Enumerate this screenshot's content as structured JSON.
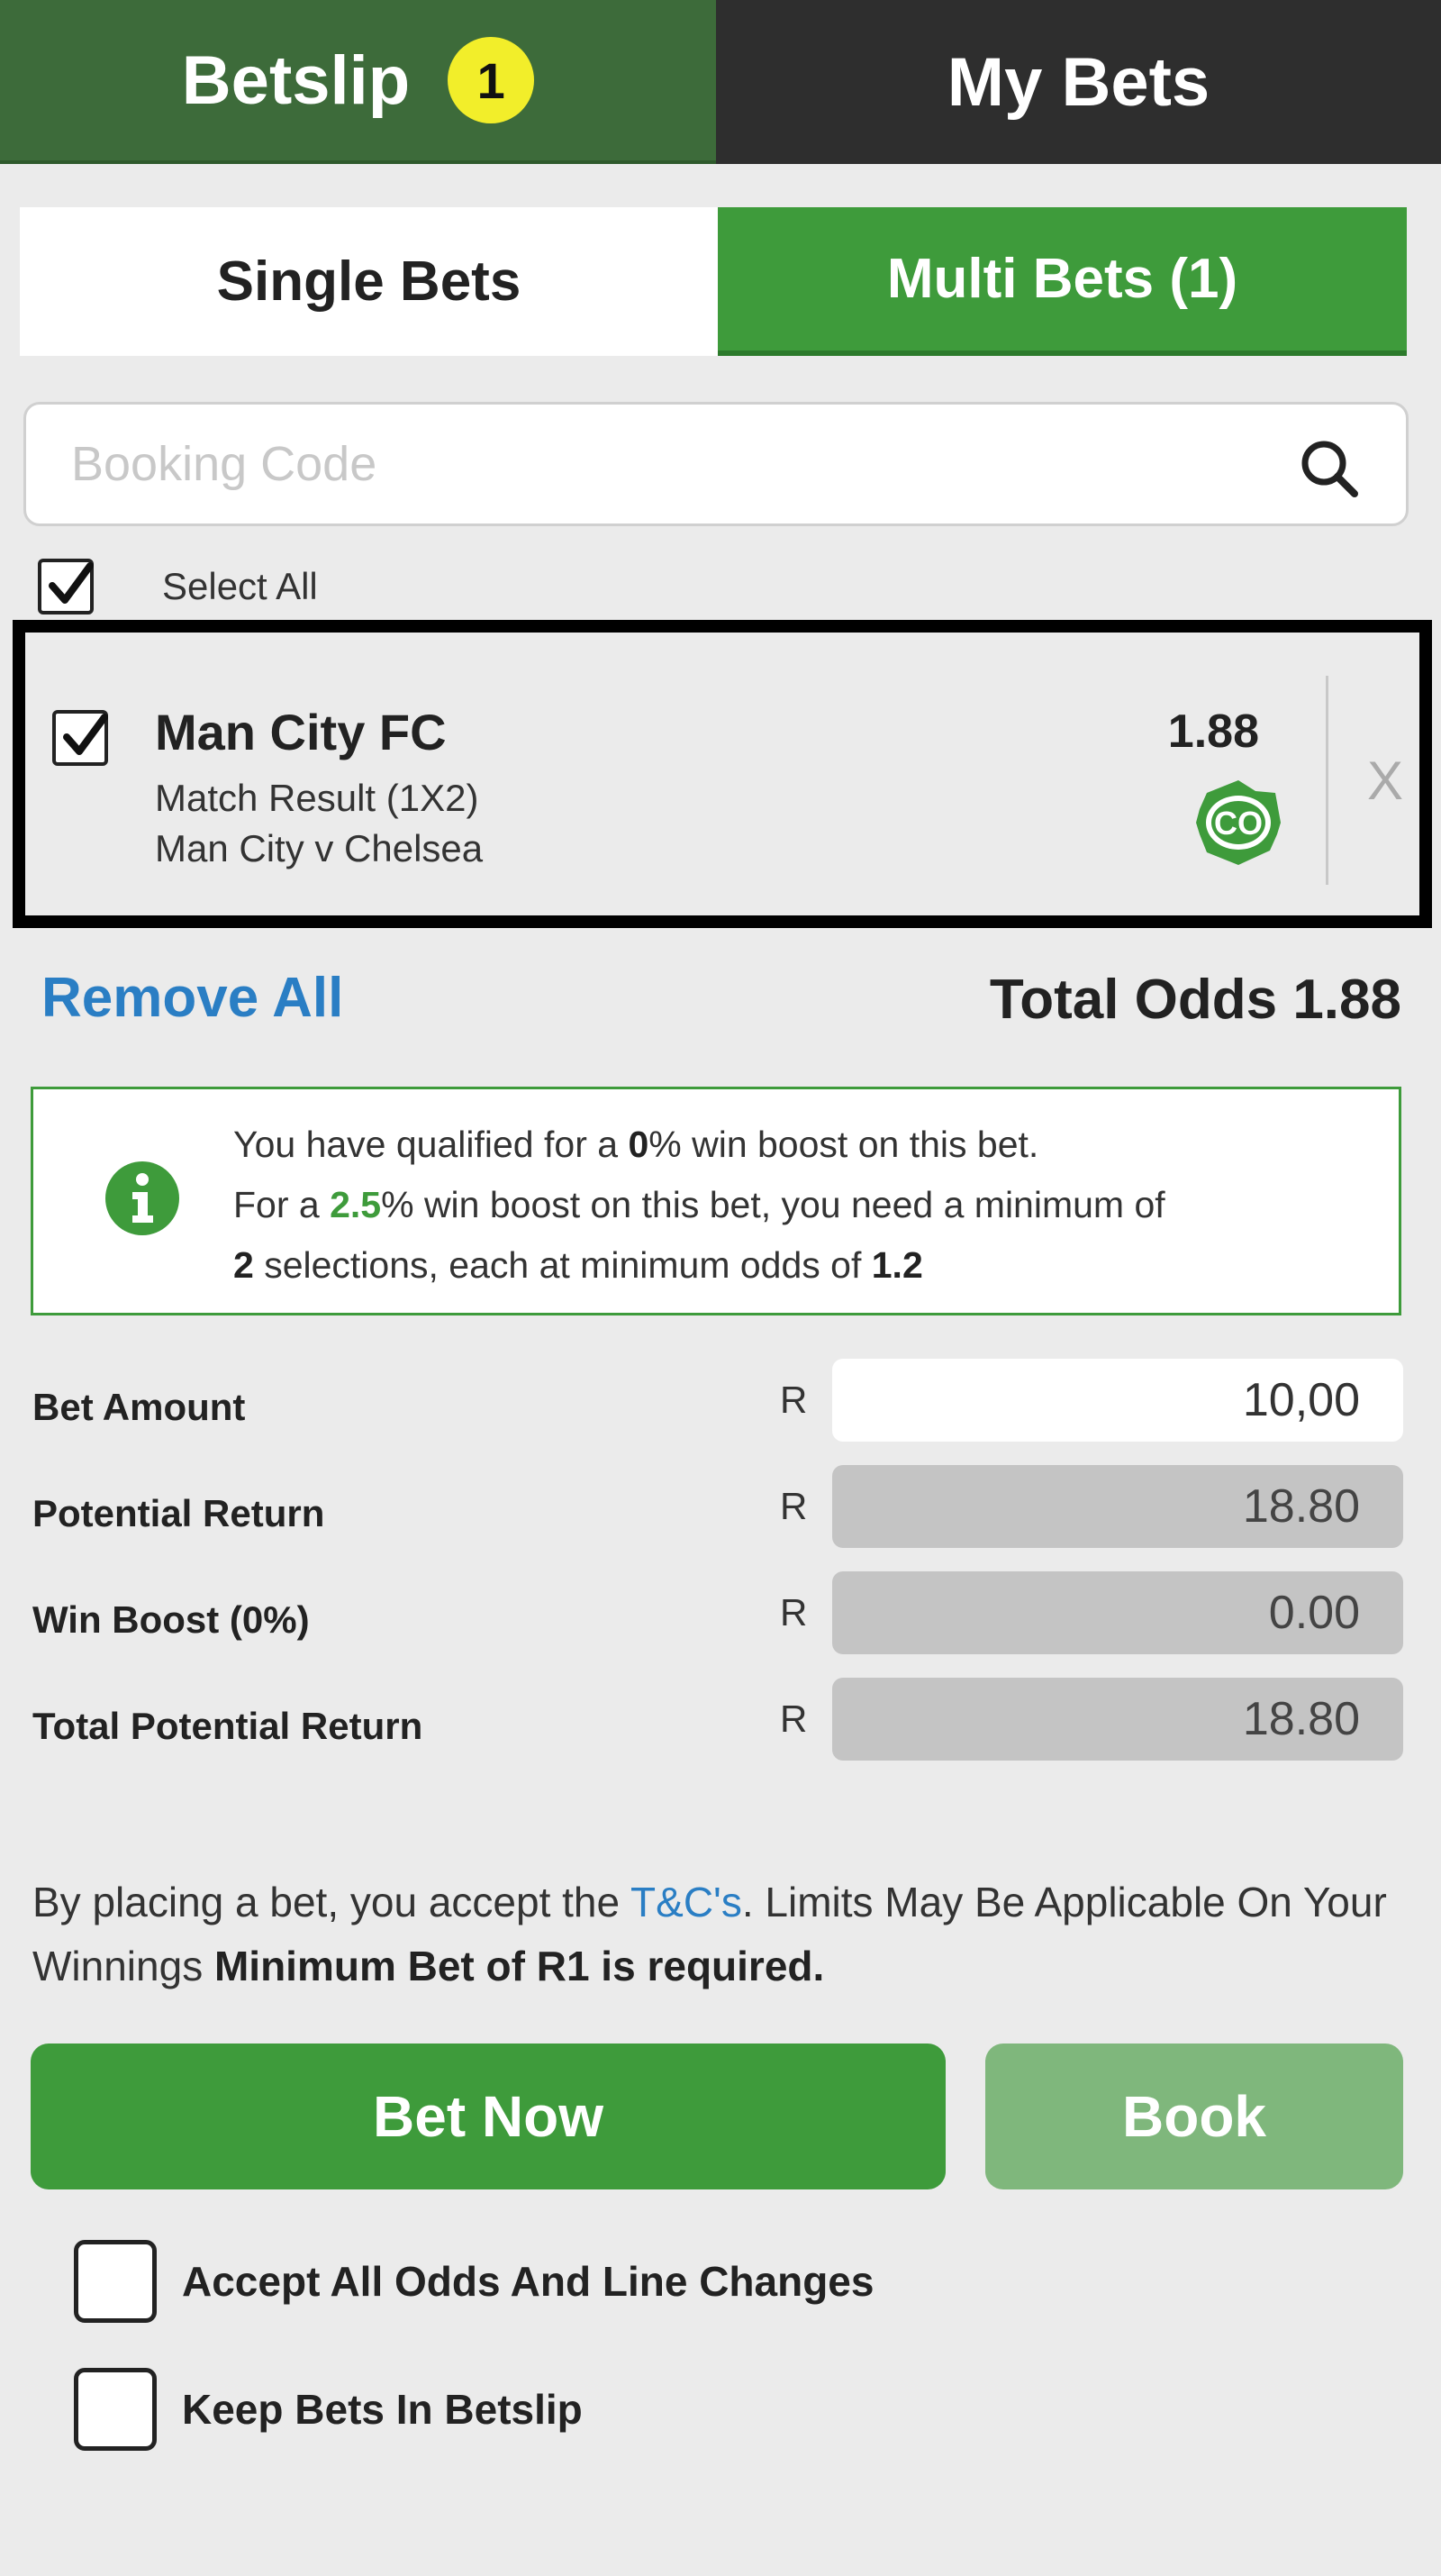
{
  "tabs": {
    "betslip": "Betslip",
    "betslip_count": "1",
    "my_bets": "My Bets"
  },
  "bet_type": {
    "single": "Single Bets",
    "multi": "Multi Bets (1)"
  },
  "booking": {
    "placeholder": "Booking Code",
    "value": ""
  },
  "select_all": {
    "label": "Select All",
    "checked": true
  },
  "selection": {
    "team": "Man City FC",
    "market": "Match Result (1X2)",
    "match": "Man City v Chelsea",
    "odds": "1.88",
    "badge_icon": "co-icon",
    "remove": "X",
    "checked": true
  },
  "summary": {
    "remove_all": "Remove All",
    "total_odds": "Total Odds 1.88"
  },
  "info": {
    "line1_a": "You have qualified for a ",
    "line1_pct": "0",
    "line1_b": "% win boost on this bet.",
    "line2_a": "For a ",
    "line2_pct": "2.5",
    "line2_b": "% win boost on this bet, you need a minimum of",
    "line3_count": "2",
    "line3_a": " selections, each at minimum odds of ",
    "line3_odds": "1.2"
  },
  "bet": {
    "currency": "R",
    "amount_label": "Bet Amount",
    "amount_value": "10,00",
    "potential_label": "Potential Return",
    "potential_value": "18.80",
    "boost_label": "Win Boost (0%)",
    "boost_value": "0.00",
    "total_label": "Total Potential Return",
    "total_value": "18.80"
  },
  "terms": {
    "text_a": "By placing a bet, you accept the ",
    "link": "T&C's",
    "text_b": ". Limits May Be Applicable On Your Winnings ",
    "bold": "Minimum Bet of R1 is required."
  },
  "actions": {
    "bet_now": "Bet Now",
    "book": "Book"
  },
  "options": {
    "accept_changes": "Accept All Odds And Line Changes",
    "keep_bets": "Keep Bets In Betslip"
  },
  "colors": {
    "green": "#3e9b3b",
    "dark_green": "#3d6b3a",
    "link_blue": "#2a7ec4",
    "badge_yellow": "#f2ee2a"
  }
}
